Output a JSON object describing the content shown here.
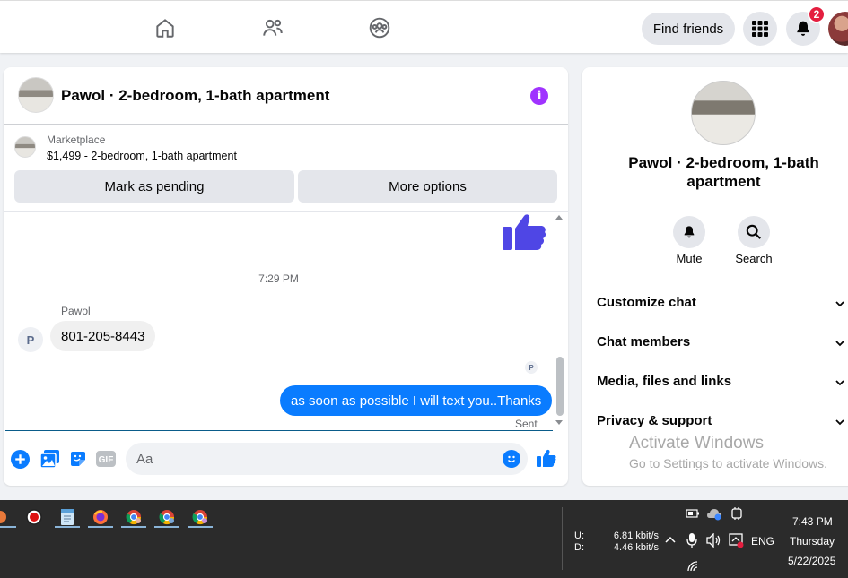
{
  "topnav": {
    "find_friends": "Find friends",
    "notification_count": "2"
  },
  "chat": {
    "title": "Pawol · 2-bedroom, 1-bath apartment",
    "marketplace_label": "Marketplace",
    "listing": "$1,499 - 2-bedroom, 1-bath apartment",
    "mark_pending": "Mark as pending",
    "more_options": "More options",
    "time_separator": "7:29 PM",
    "sender_name": "Pawol",
    "sender_initial": "P",
    "incoming_message": "801-205-8443",
    "outgoing_message": "as soon as possible I will text you..Thanks",
    "sent_status": "Sent",
    "input_placeholder": "Aa",
    "gif_label": "GIF"
  },
  "details": {
    "title": "Pawol · 2-bedroom, 1-bath apartment",
    "mute": "Mute",
    "search": "Search",
    "sections": [
      "Customize chat",
      "Chat members",
      "Media, files and links",
      "Privacy & support"
    ]
  },
  "watermark": {
    "line1": "Activate Windows",
    "line2": "Go to Settings to activate Windows."
  },
  "taskbar": {
    "upload_label": "U:",
    "download_label": "D:",
    "upload_speed": "6.81 kbit/s",
    "download_speed": "4.46 kbit/s",
    "language": "ENG",
    "time": "7:43 PM",
    "day": "Thursday",
    "date": "5/22/2025"
  },
  "colors": {
    "messenger_blue": "#0a7cff",
    "info_purple": "#a033ff",
    "notification_red": "#e41e3f"
  }
}
